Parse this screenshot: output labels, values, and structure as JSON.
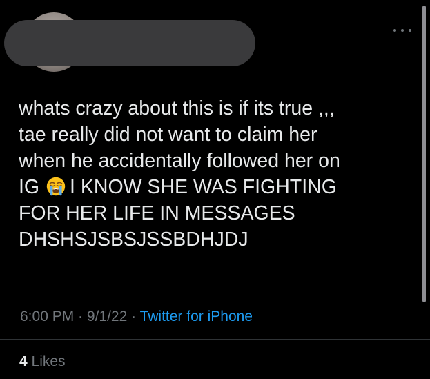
{
  "tweet": {
    "text_before_emoji": "whats crazy about this is if its true ,,,\ntae really did not want to claim her\nwhen he accidentally followed her on\nIG",
    "emoji_icon": "loudly-crying-face-icon",
    "text_after_emoji": "I KNOW SHE WAS FIGHTING\nFOR HER LIFE IN MESSAGES\nDHSHSJSBSJSSBDHJDJ"
  },
  "meta": {
    "time": "6:00 PM",
    "separator_1": " · ",
    "date": "9/1/22",
    "separator_2": " · ",
    "source": "Twitter for iPhone"
  },
  "engagement": {
    "likes_count": "4",
    "likes_label": "Likes"
  },
  "icons": {
    "more": "more-horizontal-icon"
  },
  "colors": {
    "background": "#000000",
    "text": "#e7e9ea",
    "secondary_text": "#71767b",
    "link": "#1d9bf0",
    "redaction": "#3a3a3c",
    "divider": "#2f3336"
  }
}
